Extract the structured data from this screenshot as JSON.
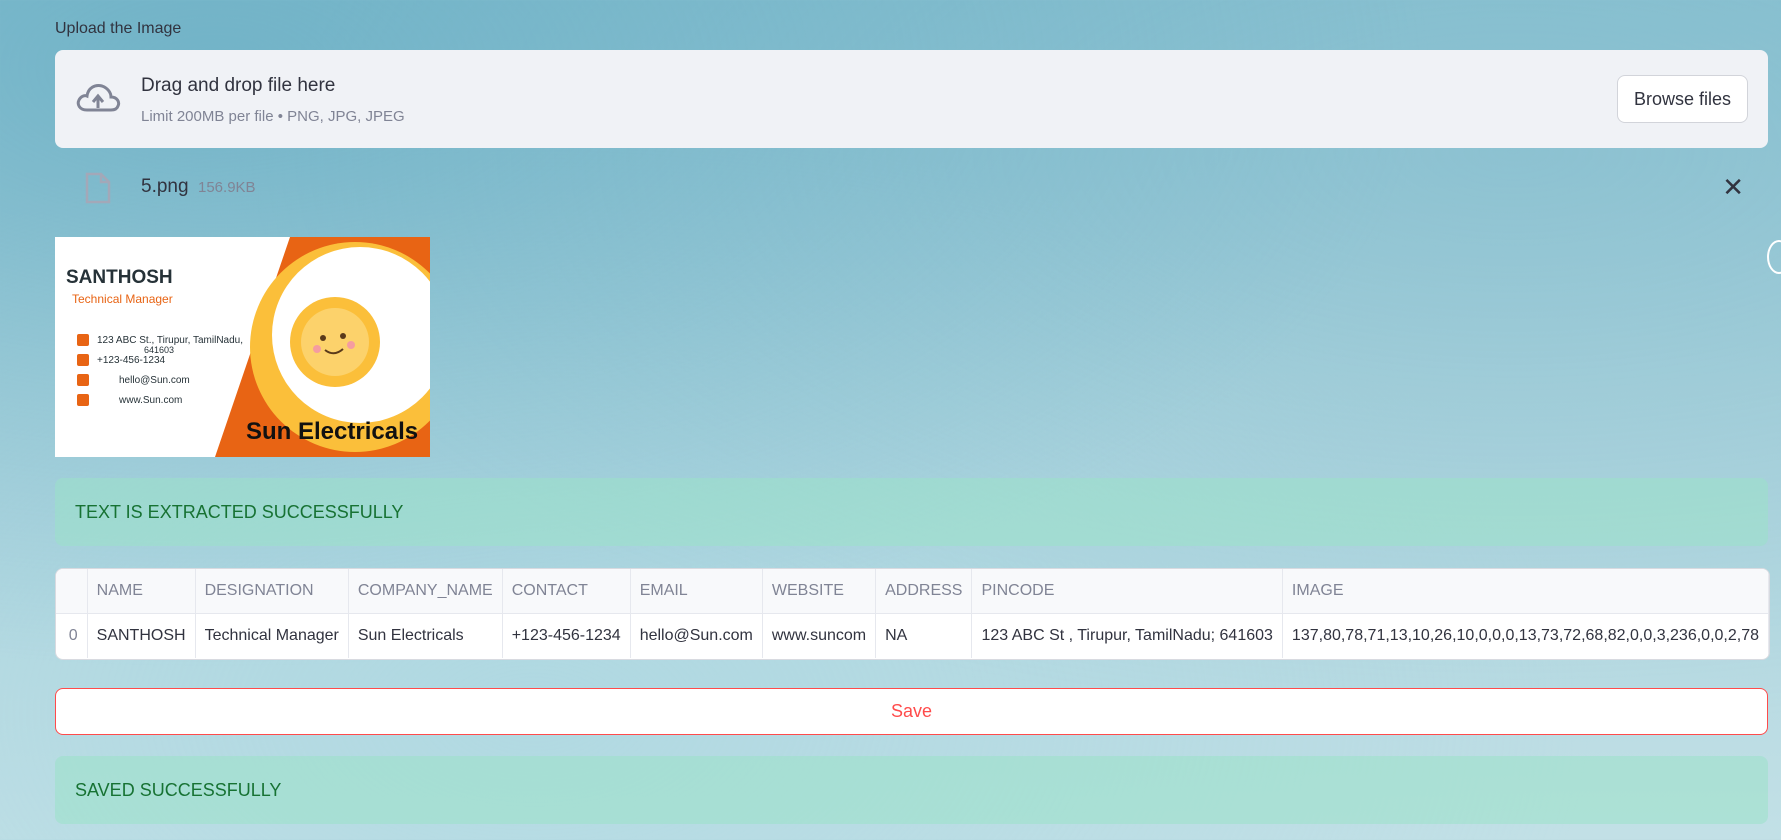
{
  "upload": {
    "label": "Upload the Image",
    "drop_title": "Drag and drop file here",
    "drop_subtitle": "Limit 200MB per file • PNG, JPG, JPEG",
    "browse_label": "Browse files"
  },
  "file": {
    "name": "5.png",
    "size": "156.9KB",
    "close": "✕"
  },
  "card": {
    "name": "SANTHOSH",
    "title": "Technical Manager",
    "address": "123 ABC St., Tirupur, TamilNadu,",
    "pincode": "641603",
    "phone": "+123-456-1234",
    "email": "hello@Sun.com",
    "website": "www.Sun.com",
    "company": "Sun Electricals"
  },
  "alerts": {
    "extracted": "TEXT IS EXTRACTED SUCCESSFULLY",
    "saved": "SAVED SUCCESSFULLY"
  },
  "table": {
    "columns": [
      "",
      "NAME",
      "DESIGNATION",
      "COMPANY_NAME",
      "CONTACT",
      "EMAIL",
      "WEBSITE",
      "ADDRESS",
      "PINCODE",
      "IMAGE"
    ],
    "row": [
      "0",
      "SANTHOSH",
      "Technical Manager",
      "Sun Electricals",
      "+123-456-1234",
      "hello@Sun.com",
      "www.suncom",
      "NA",
      "123 ABC St , Tirupur, TamilNadu; 641603",
      "137,80,78,71,13,10,26,10,0,0,0,13,73,72,68,82,0,0,3,236,0,0,2,78"
    ]
  },
  "save_label": "Save",
  "colors": {
    "accent_red": "#ff4b4b",
    "success_text": "#177233",
    "card_orange": "#e86414",
    "sun_yellow": "#fbbf3a"
  }
}
